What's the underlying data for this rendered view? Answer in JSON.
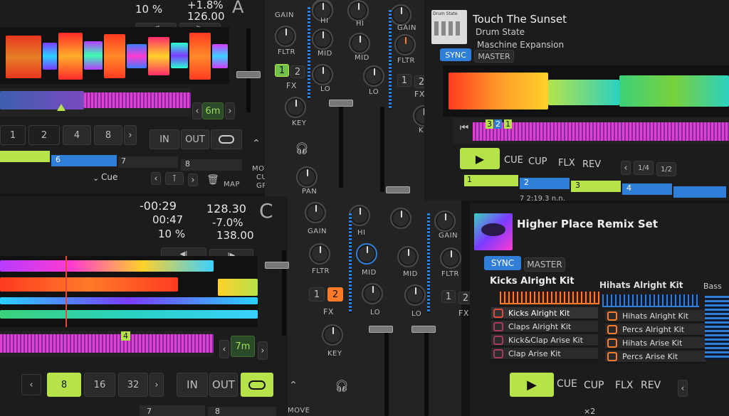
{
  "deck_a": {
    "letter": "A",
    "readouts": [
      "10 %",
      "+1.8%",
      "126.00"
    ],
    "jump_back": "◀I",
    "jump_fwd": "I▶",
    "loop_size": "6m",
    "beat_buttons": [
      "1",
      "2",
      "4",
      "8"
    ],
    "in": "IN",
    "out": "OUT",
    "cue_markers": [
      "6",
      "7",
      "8"
    ],
    "cue_menu": "Cue",
    "move": "MOVE",
    "cue": "CUE",
    "grid": "GRID",
    "map": "MAP"
  },
  "deck_c": {
    "letter": "C",
    "time_a": "-00:29",
    "time_b": "00:47",
    "pitch_range": "10 %",
    "bpm": "128.30",
    "pitch": "-7.0%",
    "tempo": "138.00",
    "jump_back": "◀I",
    "jump_fwd": "I▶",
    "loop_size": "7m",
    "beat_marker": "4",
    "beat_buttons": [
      "8",
      "16",
      "32"
    ],
    "in": "IN",
    "out": "OUT",
    "cue_markers": [
      "7",
      "8"
    ],
    "move": "MOVE"
  },
  "mixer": {
    "gain": "GAIN",
    "hi": "HI",
    "mid": "MID",
    "lo": "LO",
    "fltr": "FLTR",
    "fx": "FX",
    "fx1": "1",
    "fx2": "2",
    "key": "KEY",
    "pan": "PAN"
  },
  "deck_b": {
    "title": "Touch The Sunset",
    "artist": "Drum State",
    "album": "Maschine Expansion",
    "art_label": "Drum State",
    "sync": "SYNC",
    "master": "MASTER",
    "markers": [
      "3",
      "2",
      "1"
    ],
    "play": "▶",
    "cue": "CUE",
    "cup": "CUP",
    "flx": "FLX",
    "rev": "REV",
    "loop_vals": [
      "1/4",
      "1/2"
    ],
    "cue_markers": [
      "1",
      "2",
      "3",
      "4"
    ],
    "position": "7  2:19.3  n.n."
  },
  "deck_d": {
    "title": "Higher Place Remix Set",
    "sync": "SYNC",
    "master": "MASTER",
    "slot1_title": "Kicks Alright Kit",
    "slot1_rows": [
      "Kicks Alright Kit",
      "Claps Alright Kit",
      "Kick&Clap Arise Kit",
      "Clap Arise Kit"
    ],
    "slot2_title": "Hihats Alright Kit",
    "slot2_rows": [
      "Hihats Alright Kit",
      "Percs Alright Kit",
      "Hihats Arise Kit",
      "Percs Arise Kit"
    ],
    "slot3_title": "Bass",
    "play": "▶",
    "cue": "CUE",
    "cup": "CUP",
    "flx": "FLX",
    "rev": "REV",
    "multiplier": "×2"
  },
  "colors": {
    "lime": "#b6e24a",
    "blue": "#2f7fd8",
    "orange": "#ff7a29",
    "red": "#e2483d"
  }
}
